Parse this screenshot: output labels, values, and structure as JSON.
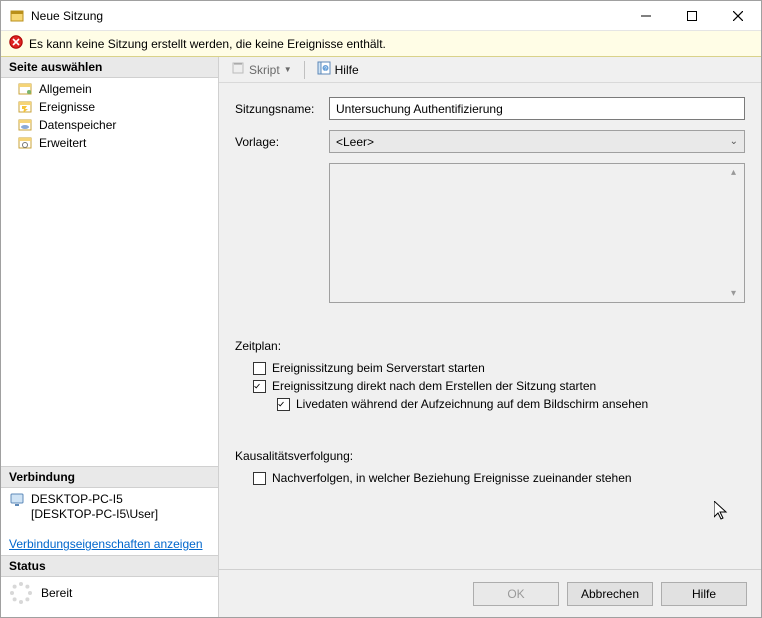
{
  "title": "Neue Sitzung",
  "notify_text": "Es kann keine Sitzung erstellt werden, die keine Ereignisse enthält.",
  "sidebar": {
    "head_pages": "Seite auswählen",
    "items": [
      {
        "label": "Allgemein"
      },
      {
        "label": "Ereignisse"
      },
      {
        "label": "Datenspeicher"
      },
      {
        "label": "Erweitert"
      }
    ],
    "head_conn": "Verbindung",
    "conn_name": "DESKTOP-PC-I5",
    "conn_user": "[DESKTOP-PC-I5\\User]",
    "conn_link": "Verbindungseigenschaften anzeigen",
    "head_status": "Status",
    "status_text": "Bereit"
  },
  "toolbar": {
    "script_label": "Skript",
    "help_label": "Hilfe"
  },
  "form": {
    "name_label": "Sitzungsname:",
    "name_value": "Untersuchung Authentifizierung",
    "template_label": "Vorlage:",
    "template_value": "<Leer>",
    "schedule_label": "Zeitplan:",
    "chk_start_on_server": "Ereignissitzung beim Serverstart starten",
    "chk_start_after_create": "Ereignissitzung direkt nach dem Erstellen der Sitzung starten",
    "chk_live_data": "Livedaten während der Aufzeichnung auf dem Bildschirm ansehen",
    "causality_label": "Kausalitätsverfolgung:",
    "chk_track_relations": "Nachverfolgen, in welcher Beziehung Ereignisse zueinander stehen"
  },
  "buttons": {
    "ok": "OK",
    "cancel": "Abbrechen",
    "help": "Hilfe"
  }
}
